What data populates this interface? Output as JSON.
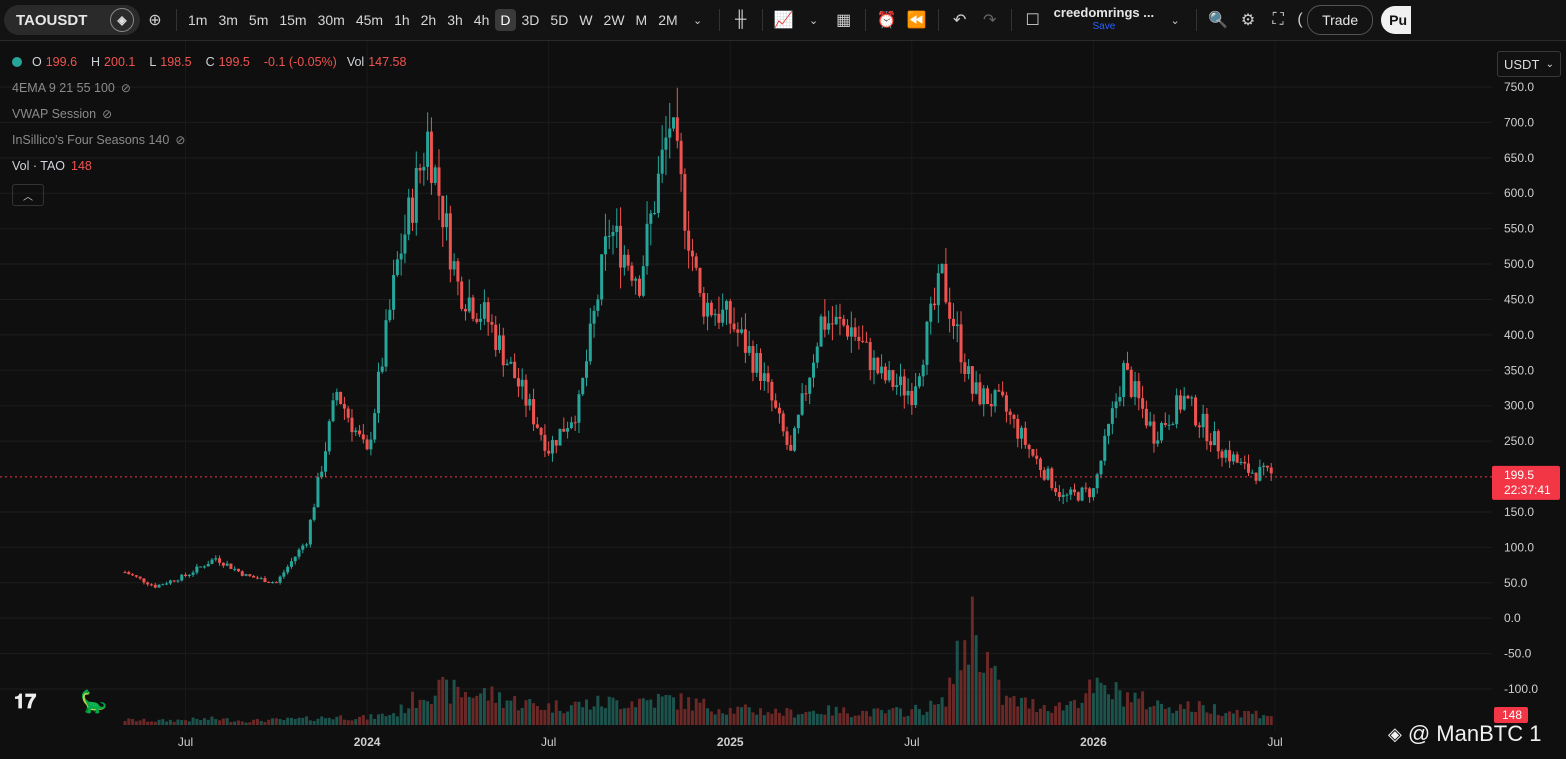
{
  "toolbar": {
    "symbol": "TAOUSDT",
    "timeframes": [
      "1m",
      "3m",
      "5m",
      "15m",
      "30m",
      "45m",
      "1h",
      "2h",
      "3h",
      "4h",
      "D",
      "3D",
      "5D",
      "W",
      "2W",
      "M",
      "2M"
    ],
    "active_timeframe": "D",
    "user_name": "creedomrings ...",
    "save_label": "Save",
    "trade_label": "Trade",
    "publish_label": "Pu"
  },
  "legend": {
    "ohlc": {
      "O": "199.6",
      "H": "200.1",
      "L": "198.5",
      "C": "199.5",
      "change": "-0.1 (-0.05%)",
      "vol": "147.58"
    },
    "indicators": [
      "4EMA 9 21 55 100",
      "VWAP Session",
      "InSillico's Four Seasons 140"
    ],
    "volume_label": "Vol · TAO",
    "volume_value": "148"
  },
  "currency_button": "USDT",
  "price_axis": {
    "ticks": [
      "750.0",
      "700.0",
      "650.0",
      "600.0",
      "550.0",
      "500.0",
      "450.0",
      "400.0",
      "350.0",
      "300.0",
      "250.0",
      "150.0",
      "100.0",
      "50.0",
      "0.0",
      "-50.0",
      "-100.0"
    ],
    "current_price": "199.5",
    "countdown": "22:37:41",
    "volume_badge": "148"
  },
  "time_axis": {
    "labels": [
      "Jul",
      "2024",
      "Jul",
      "2025",
      "Jul",
      "2026",
      "Jul"
    ]
  },
  "watermark": "@ ManBTC 1",
  "colors": {
    "up": "#26a69a",
    "down": "#ef5350",
    "background": "#0f0f0f",
    "price_tag": "#f23645"
  },
  "chart_data": {
    "type": "candlestick",
    "title": "",
    "symbol": "TAOUSDT",
    "x": [
      "2023-05",
      "2023-06",
      "2023-07",
      "2023-08",
      "2023-09",
      "2023-10",
      "2023-11",
      "2023-12",
      "2024-01",
      "2024-02",
      "2024-03",
      "2024-04",
      "2024-05",
      "2024-06",
      "2024-07",
      "2024-08",
      "2024-09",
      "2024-10",
      "2024-11",
      "2024-12",
      "2025-01",
      "2025-02",
      "2025-03",
      "2025-04",
      "2025-05",
      "2025-06",
      "2025-07",
      "2025-08",
      "2025-09",
      "2025-10",
      "2025-11",
      "2025-12",
      "2026-01",
      "2026-02",
      "2026-03",
      "2026-04",
      "2026-05",
      "2026-06",
      "2026-07"
    ],
    "close": [
      65,
      45,
      60,
      85,
      60,
      50,
      110,
      320,
      230,
      500,
      680,
      470,
      420,
      330,
      240,
      300,
      550,
      480,
      700,
      450,
      420,
      350,
      230,
      420,
      410,
      340,
      320,
      480,
      320,
      300,
      230,
      170,
      180,
      350,
      260,
      310,
      250,
      210,
      199.5
    ],
    "volume_relative": [
      0.05,
      0.04,
      0.05,
      0.06,
      0.04,
      0.05,
      0.06,
      0.08,
      0.07,
      0.12,
      0.35,
      0.32,
      0.3,
      0.22,
      0.18,
      0.2,
      0.22,
      0.24,
      0.25,
      0.2,
      0.15,
      0.14,
      0.12,
      0.14,
      0.13,
      0.12,
      0.14,
      0.2,
      1.0,
      0.25,
      0.2,
      0.18,
      0.35,
      0.3,
      0.2,
      0.18,
      0.16,
      0.12,
      0.1
    ],
    "ylim": [
      -100,
      750
    ],
    "last_price": 199.5
  }
}
